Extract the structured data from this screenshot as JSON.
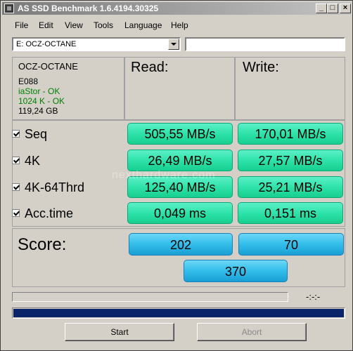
{
  "window": {
    "title": "AS SSD Benchmark 1.6.4194.30325",
    "icon": "app-icon",
    "controls": [
      "minimize-icon",
      "maximize-icon",
      "close-icon"
    ]
  },
  "menu": [
    "File",
    "Edit",
    "View",
    "Tools",
    "Language",
    "Help"
  ],
  "drive_select": {
    "value": "E: OCZ-OCTANE"
  },
  "info": {
    "name": "OCZ-OCTANE",
    "firmware": "E088",
    "driver": "iaStor - OK",
    "alignment": "1024 K - OK",
    "size": "119,24 GB",
    "ok_color": "#008000"
  },
  "headers": {
    "read": "Read:",
    "write": "Write:"
  },
  "tests": [
    {
      "label": "Seq",
      "checked": true,
      "read": "505,55 MB/s",
      "write": "170,01 MB/s"
    },
    {
      "label": "4K",
      "checked": true,
      "read": "26,49 MB/s",
      "write": "27,57 MB/s"
    },
    {
      "label": "4K-64Thrd",
      "checked": true,
      "read": "125,40 MB/s",
      "write": "25,21 MB/s"
    },
    {
      "label": "Acc.time",
      "checked": true,
      "read": "0,049 ms",
      "write": "0,151 ms"
    }
  ],
  "score": {
    "label": "Score:",
    "read": "202",
    "write": "70",
    "total": "370"
  },
  "status": {
    "time": "-:-:-",
    "progress": 1.0
  },
  "buttons": {
    "start": "Start",
    "abort": "Abort"
  },
  "watermark": "nexthardware.com",
  "colors": {
    "result": "#2fe2a9",
    "score": "#32bdea",
    "progress": "#0a246a"
  }
}
